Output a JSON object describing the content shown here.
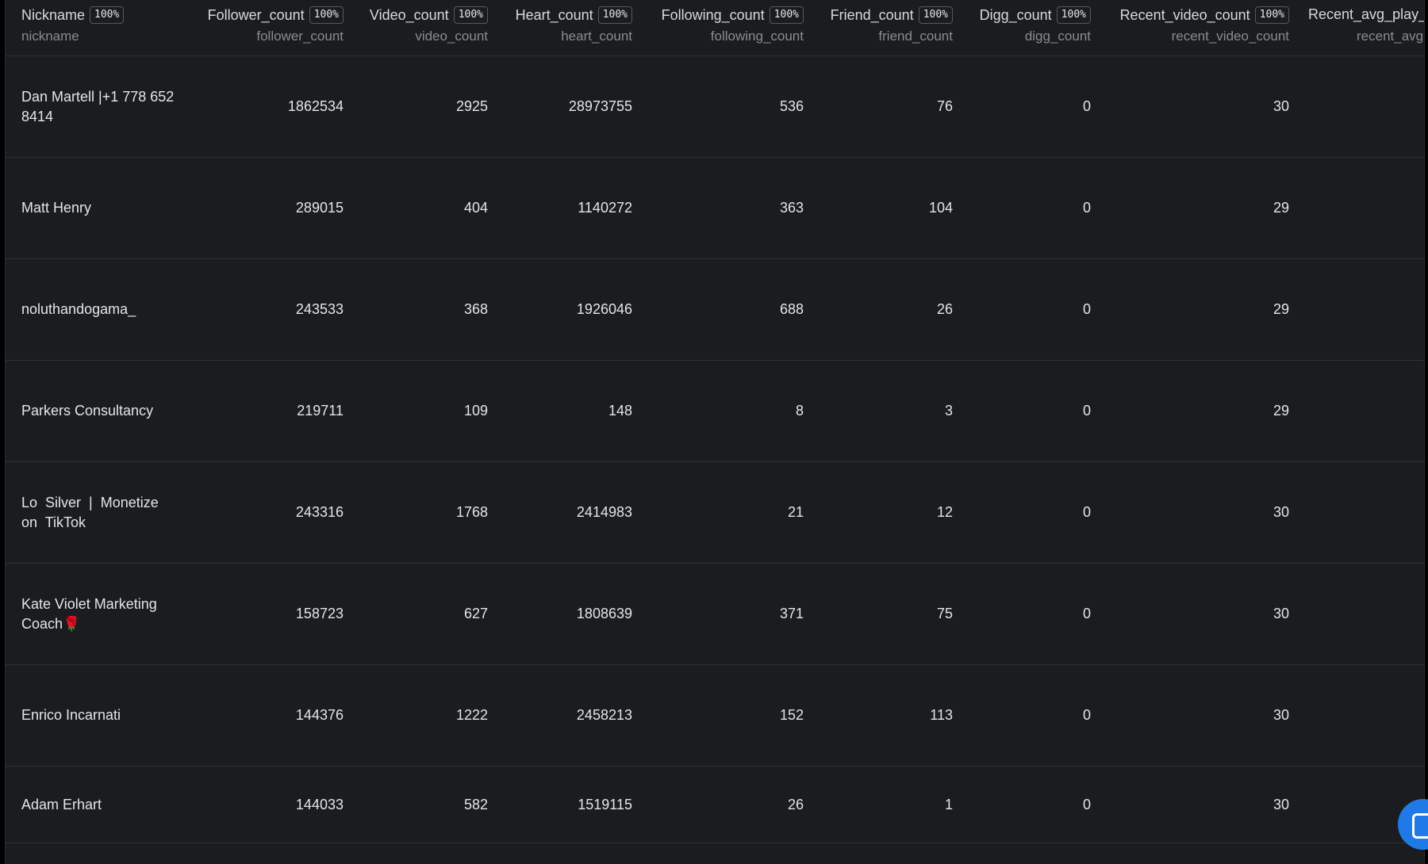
{
  "table": {
    "columns": [
      {
        "key": "nickname",
        "title": "Nickname",
        "badge": "100%",
        "sub": "nickname"
      },
      {
        "key": "follower_count",
        "title": "Follower_count",
        "badge": "100%",
        "sub": "follower_count"
      },
      {
        "key": "video_count",
        "title": "Video_count",
        "badge": "100%",
        "sub": "video_count"
      },
      {
        "key": "heart_count",
        "title": "Heart_count",
        "badge": "100%",
        "sub": "heart_count"
      },
      {
        "key": "following_count",
        "title": "Following_count",
        "badge": "100%",
        "sub": "following_count"
      },
      {
        "key": "friend_count",
        "title": "Friend_count",
        "badge": "100%",
        "sub": "friend_count"
      },
      {
        "key": "digg_count",
        "title": "Digg_count",
        "badge": "100%",
        "sub": "digg_count"
      },
      {
        "key": "recent_video_count",
        "title": "Recent_video_count",
        "badge": "100%",
        "sub": "recent_video_count"
      },
      {
        "key": "recent_avg_play",
        "title": "Recent_avg_play_",
        "sub": "recent_avg"
      }
    ],
    "rows": [
      {
        "nickname": [
          "Dan Martell |+1 778 652",
          "8414"
        ],
        "follower_count": "1862534",
        "video_count": "2925",
        "heart_count": "28973755",
        "following_count": "536",
        "friend_count": "76",
        "digg_count": "0",
        "recent_video_count": "30"
      },
      {
        "nickname": [
          "Matt Henry"
        ],
        "follower_count": "289015",
        "video_count": "404",
        "heart_count": "1140272",
        "following_count": "363",
        "friend_count": "104",
        "digg_count": "0",
        "recent_video_count": "29"
      },
      {
        "nickname": [
          "noluthandogama_"
        ],
        "follower_count": "243533",
        "video_count": "368",
        "heart_count": "1926046",
        "following_count": "688",
        "friend_count": "26",
        "digg_count": "0",
        "recent_video_count": "29"
      },
      {
        "nickname": [
          "Parkers Consultancy"
        ],
        "follower_count": "219711",
        "video_count": "109",
        "heart_count": "148",
        "following_count": "8",
        "friend_count": "3",
        "digg_count": "0",
        "recent_video_count": "29"
      },
      {
        "nickname": [
          "Lo  Silver  |  Monetize",
          "on  TikTok"
        ],
        "follower_count": "243316",
        "video_count": "1768",
        "heart_count": "2414983",
        "following_count": "21",
        "friend_count": "12",
        "digg_count": "0",
        "recent_video_count": "30"
      },
      {
        "nickname": [
          "Kate Violet Marketing",
          "Coach🌹"
        ],
        "follower_count": "158723",
        "video_count": "627",
        "heart_count": "1808639",
        "following_count": "371",
        "friend_count": "75",
        "digg_count": "0",
        "recent_video_count": "30"
      },
      {
        "nickname": [
          "Enrico Incarnati"
        ],
        "follower_count": "144376",
        "video_count": "1222",
        "heart_count": "2458213",
        "following_count": "152",
        "friend_count": "113",
        "digg_count": "0",
        "recent_video_count": "30"
      },
      {
        "nickname": [
          "Adam Erhart"
        ],
        "follower_count": "144033",
        "video_count": "582",
        "heart_count": "1519115",
        "following_count": "26",
        "friend_count": "1",
        "digg_count": "0",
        "recent_video_count": "30"
      }
    ]
  },
  "chat_widget": {
    "icon": "chat-icon",
    "color": "#1f7ae8"
  }
}
